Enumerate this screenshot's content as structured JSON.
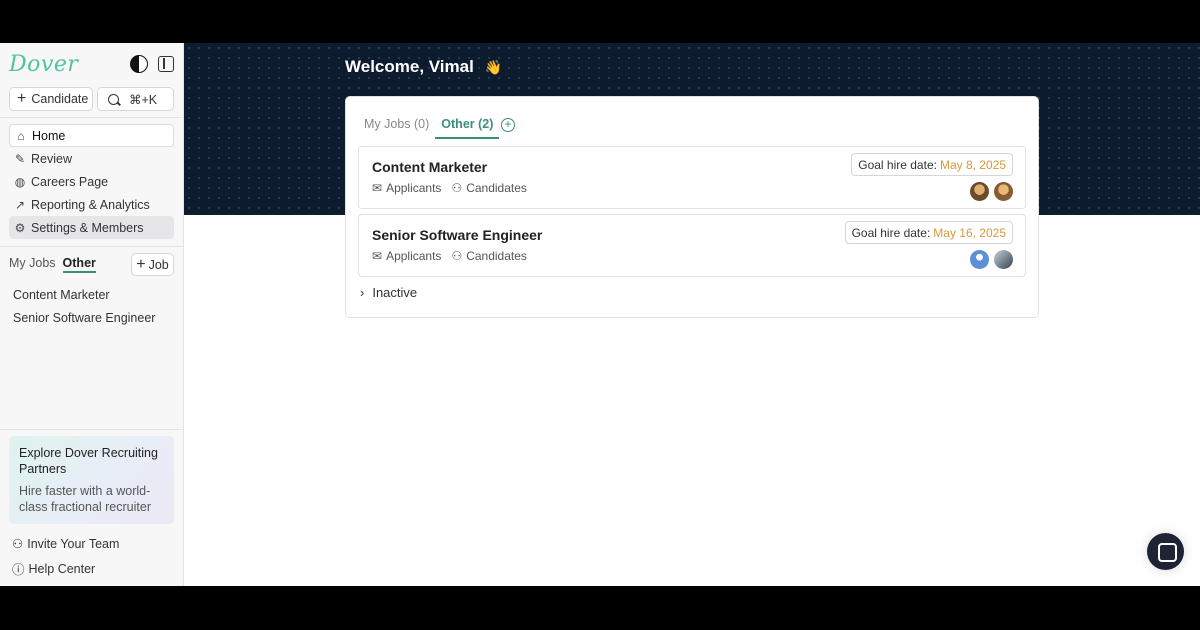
{
  "sidebar": {
    "logo": "Dover",
    "candidate_btn": "Candidate",
    "search_shortcut": "⌘+K",
    "nav": [
      "Home",
      "Review",
      "Careers Page",
      "Reporting & Analytics",
      "Settings & Members"
    ],
    "jobs_tabs": {
      "my_jobs": "My Jobs",
      "other": "Other"
    },
    "job_btn": "Job",
    "jobs": [
      "Content Marketer",
      "Senior Software Engineer"
    ],
    "promo": {
      "title": "Explore Dover Recruiting Partners",
      "subtitle": "Hire faster with a world-class fractional recruiter"
    },
    "footer": [
      "Invite Your Team",
      "Help Center"
    ]
  },
  "main": {
    "welcome": "Welcome, Vimal",
    "wave": "👋",
    "tabs": {
      "my_jobs": "My Jobs (0)",
      "other": "Other (2)"
    },
    "goal_label": "Goal hire date:",
    "applicants_label": "Applicants",
    "candidates_label": "Candidates",
    "jobs": [
      {
        "title": "Content Marketer",
        "goal_date": "May 8, 2025"
      },
      {
        "title": "Senior Software Engineer",
        "goal_date": "May 16, 2025"
      }
    ],
    "inactive": "Inactive"
  },
  "colors": {
    "accent": "#3b8f7a",
    "hero_bg": "#0d1b2e",
    "date": "#d69a3a",
    "logo": "#4fc3a1"
  }
}
